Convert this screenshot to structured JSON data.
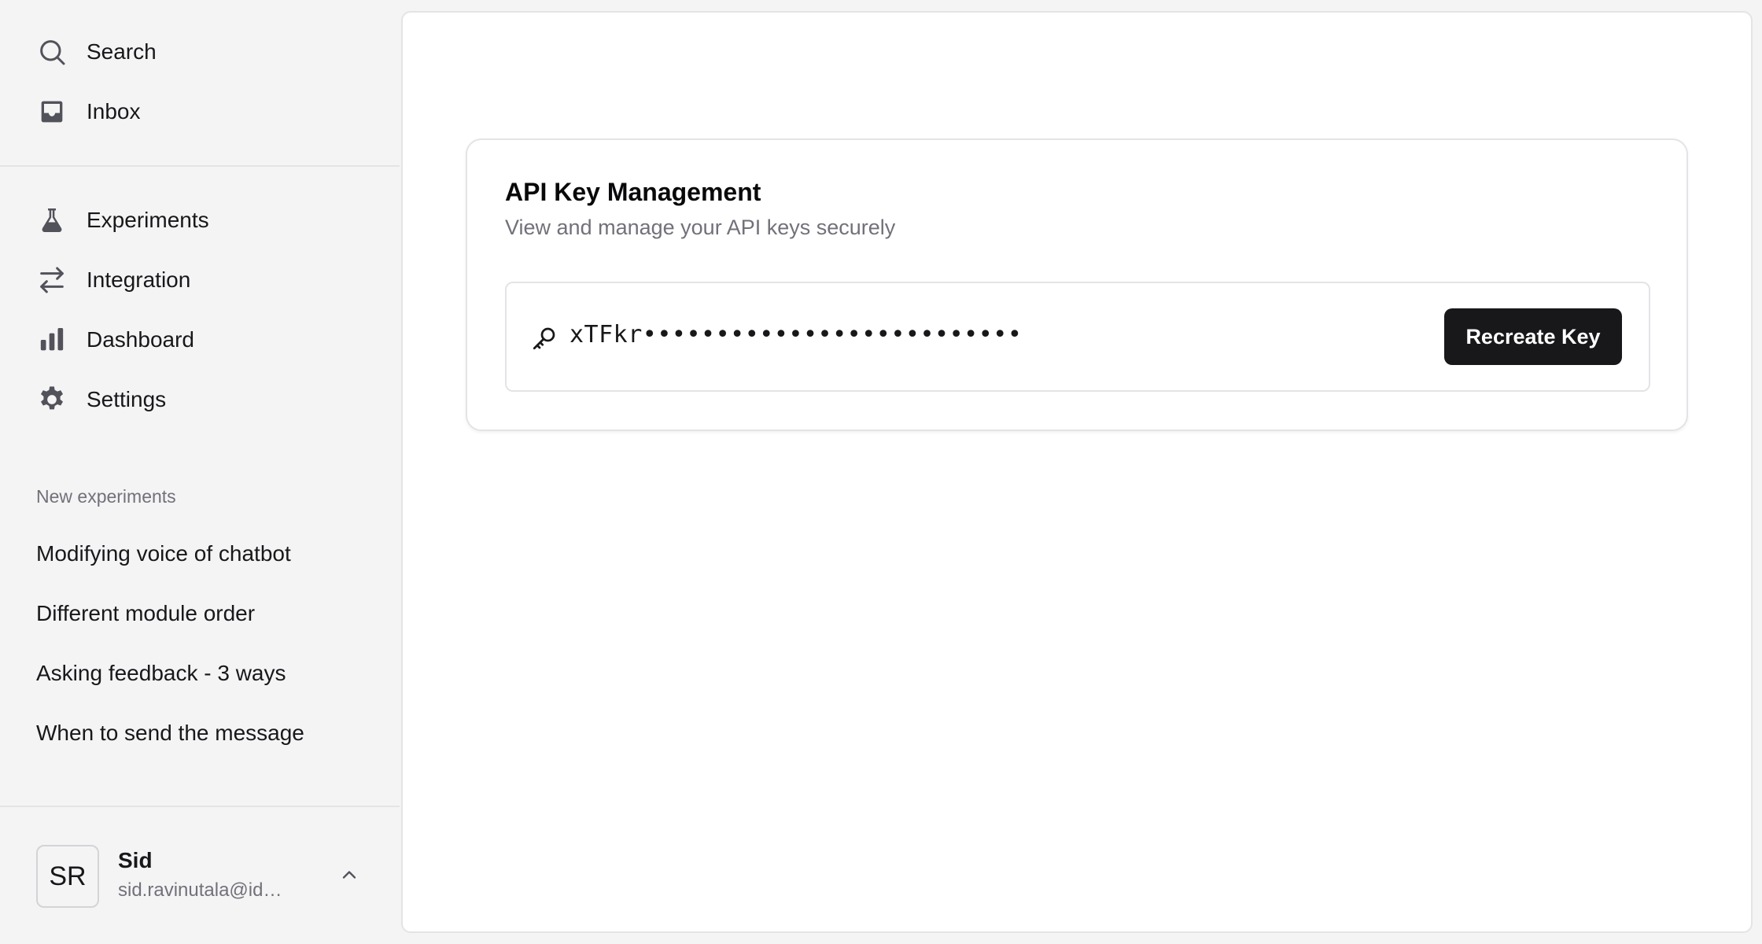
{
  "sidebar": {
    "top_items": [
      {
        "label": "Search",
        "icon": "search-icon"
      },
      {
        "label": "Inbox",
        "icon": "inbox-icon"
      }
    ],
    "main_items": [
      {
        "label": "Experiments",
        "icon": "flask-icon"
      },
      {
        "label": "Integration",
        "icon": "arrows-icon"
      },
      {
        "label": "Dashboard",
        "icon": "bar-chart-icon"
      },
      {
        "label": "Settings",
        "icon": "gear-icon"
      }
    ],
    "section_title": "New experiments",
    "experiments": [
      "Modifying voice of chatbot",
      "Different module order",
      "Asking feedback - 3 ways",
      "When to send the message"
    ],
    "user": {
      "initials": "SR",
      "name": "Sid",
      "email": "sid.ravinutala@idinsig..."
    }
  },
  "card": {
    "title": "API Key Management",
    "subtitle": "View and manage your API keys securely",
    "key_value": "xTFkr••••••••••••••••••••••••••",
    "button_label": "Recreate Key"
  },
  "colors": {
    "sidebar_bg": "#f4f4f5",
    "text_primary": "#18181b",
    "text_muted": "#71717a",
    "button_bg": "#18181b",
    "border": "#e4e4e7"
  }
}
